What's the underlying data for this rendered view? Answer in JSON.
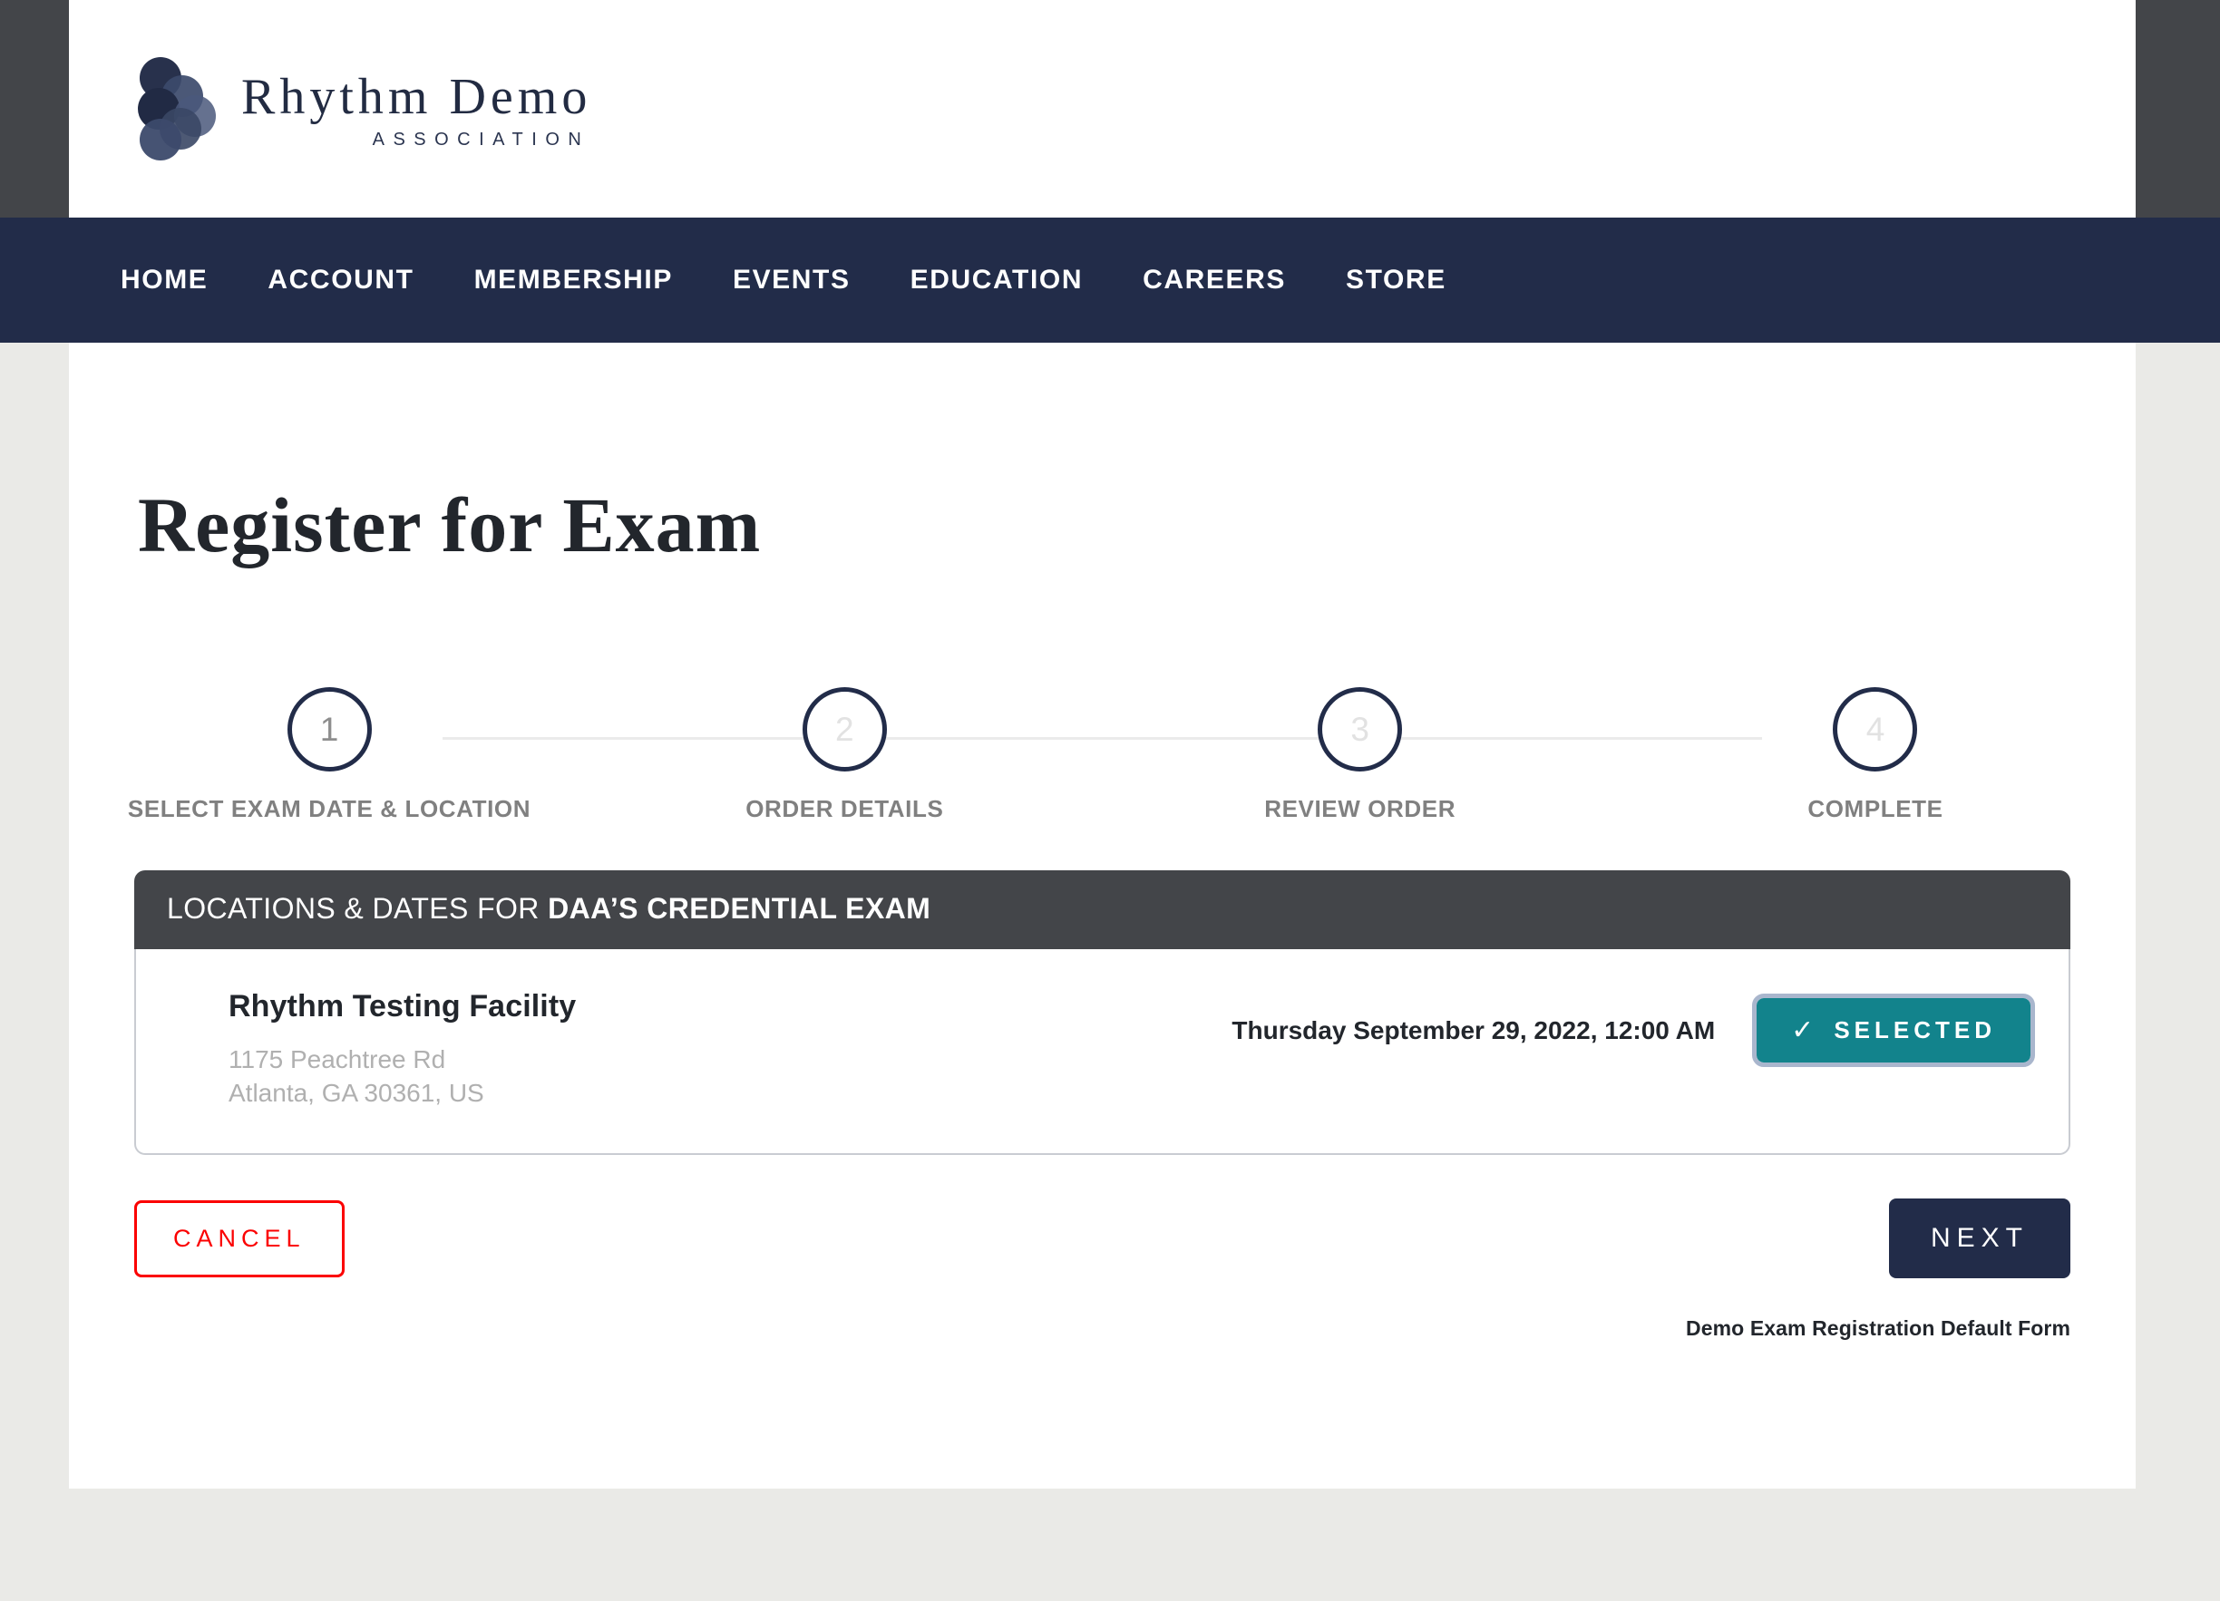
{
  "brand": {
    "title": "Rhythm Demo",
    "subtitle": "ASSOCIATION",
    "logo_icon": "rhythm-dots-logo",
    "navy": "#222c49",
    "dark_gray": "#434549"
  },
  "nav": {
    "items": [
      {
        "label": "HOME"
      },
      {
        "label": "ACCOUNT"
      },
      {
        "label": "MEMBERSHIP"
      },
      {
        "label": "EVENTS"
      },
      {
        "label": "EDUCATION"
      },
      {
        "label": "CAREERS"
      },
      {
        "label": "STORE"
      }
    ]
  },
  "main": {
    "page_title": "Register for Exam"
  },
  "stepper": {
    "steps": [
      {
        "number": "1",
        "label": "SELECT EXAM DATE & LOCATION",
        "state": "active"
      },
      {
        "number": "2",
        "label": "ORDER DETAILS",
        "state": "inactive"
      },
      {
        "number": "3",
        "label": "REVIEW ORDER",
        "state": "inactive"
      },
      {
        "number": "4",
        "label": "COMPLETE",
        "state": "inactive"
      }
    ]
  },
  "panel": {
    "header_prefix": "LOCATIONS & DATES FOR ",
    "header_exam": "DAA’S CREDENTIAL EXAM",
    "location": {
      "name": "Rhythm Testing Facility",
      "address_line1": "1175 Peachtree Rd",
      "address_line2": "Atlanta, GA 30361, US",
      "date": "Thursday September 29, 2022, 12:00 AM",
      "select_button_label": "SELECTED",
      "select_button_icon": "checkmark-icon",
      "select_button_color": "#12838c",
      "select_button_focus_ring": "#a9b6cd"
    }
  },
  "actions": {
    "cancel_label": "CANCEL",
    "cancel_color": "#fb0000",
    "next_label": "NEXT",
    "next_color": "#222c49"
  },
  "footer": {
    "form_name": "Demo Exam Registration Default Form"
  }
}
